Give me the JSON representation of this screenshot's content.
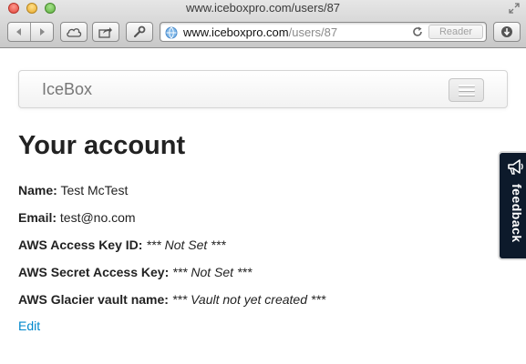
{
  "window": {
    "title": "www.iceboxpro.com/users/87"
  },
  "address_bar": {
    "host": "www.iceboxpro.com",
    "path": "/users/87",
    "reader_label": "Reader"
  },
  "navbar": {
    "brand": "IceBox"
  },
  "page": {
    "title": "Your account",
    "fields": {
      "name": {
        "label": "Name:",
        "value": "Test McTest"
      },
      "email": {
        "label": "Email:",
        "value": "test@no.com"
      },
      "aws_key": {
        "label": "AWS Access Key ID:",
        "prefix": "***",
        "value": "Not Set",
        "suffix": "***"
      },
      "aws_secret": {
        "label": "AWS Secret Access Key:",
        "prefix": "***",
        "value": "Not Set",
        "suffix": "***"
      },
      "aws_vault": {
        "label": "AWS Glacier vault name:",
        "prefix": "***",
        "value": "Vault not yet created",
        "suffix": "***"
      }
    },
    "edit_link": "Edit"
  },
  "feedback": {
    "label": "feedback"
  },
  "colors": {
    "link": "#0088cc",
    "feedback_bg": "#0d1a2b"
  }
}
